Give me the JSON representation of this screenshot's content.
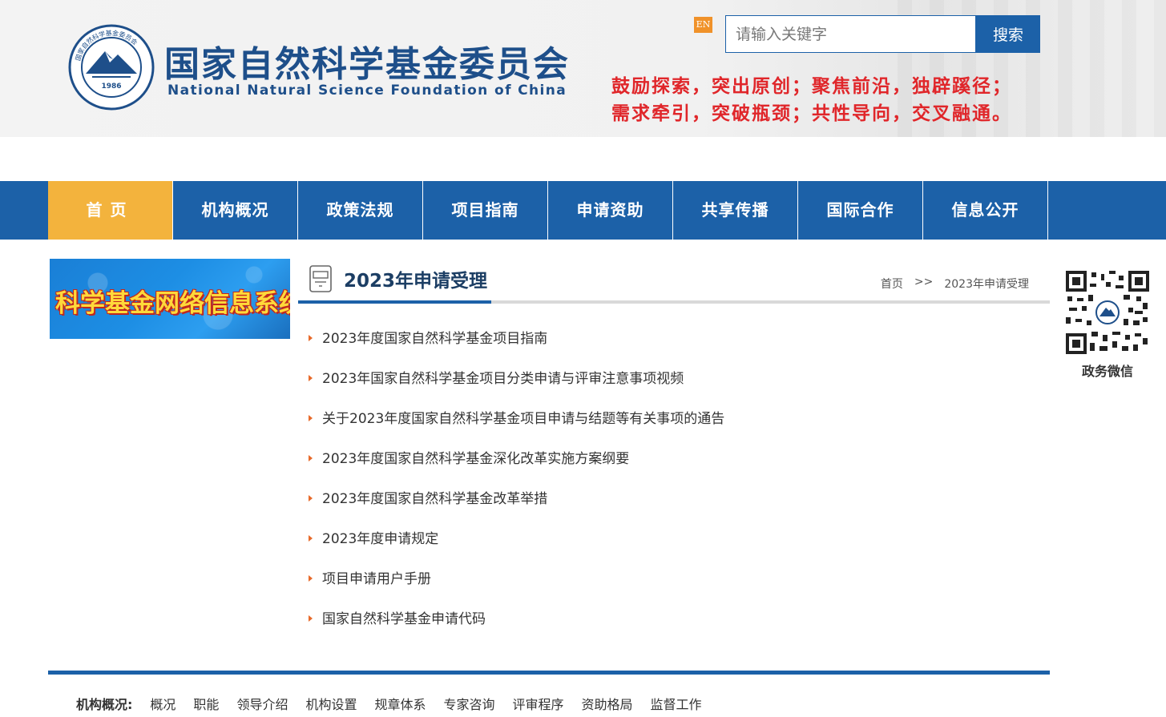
{
  "header": {
    "org_name_cn": "国家自然科学基金委员会",
    "org_name_en": "National Natural Science Foundation of China",
    "emblem_year": "1986",
    "lang_switch": "EN",
    "search_placeholder": "请输入关键字",
    "search_button": "搜索",
    "slogan_line1": "鼓励探索，突出原创；聚焦前沿，独辟蹊径；",
    "slogan_line2": "需求牵引，突破瓶颈；共性导向，交叉融通。"
  },
  "nav": {
    "items": [
      {
        "label": "首页",
        "active": true
      },
      {
        "label": "机构概况"
      },
      {
        "label": "政策法规"
      },
      {
        "label": "项目指南"
      },
      {
        "label": "申请资助"
      },
      {
        "label": "共享传播"
      },
      {
        "label": "国际合作"
      },
      {
        "label": "信息公开"
      }
    ]
  },
  "sidebar": {
    "banner_text": "科学基金网络信息系统"
  },
  "section": {
    "title": "2023年申请受理",
    "breadcrumb_home": "首页",
    "breadcrumb_sep": ">>",
    "breadcrumb_current": "2023年申请受理"
  },
  "articles": [
    "2023年度国家自然科学基金项目指南",
    "2023年国家自然科学基金项目分类申请与评审注意事项视频",
    "关于2023年度国家自然科学基金项目申请与结题等有关事项的通告",
    "2023年度国家自然科学基金深化改革实施方案纲要",
    "2023年度国家自然科学基金改革举措",
    "2023年度申请规定",
    "项目申请用户手册",
    "国家自然科学基金申请代码"
  ],
  "qr": {
    "label": "政务微信"
  },
  "footer": {
    "heading": "机构概况:",
    "links": [
      "概况",
      "职能",
      "领导介绍",
      "机构设置",
      "规章体系",
      "专家咨询",
      "评审程序",
      "资助格局",
      "监督工作"
    ]
  },
  "colors": {
    "brand_blue": "#1c61a8",
    "nav_active": "#f3b33d",
    "slogan_red": "#e0262a",
    "arrow_orange": "#e86a2a"
  }
}
